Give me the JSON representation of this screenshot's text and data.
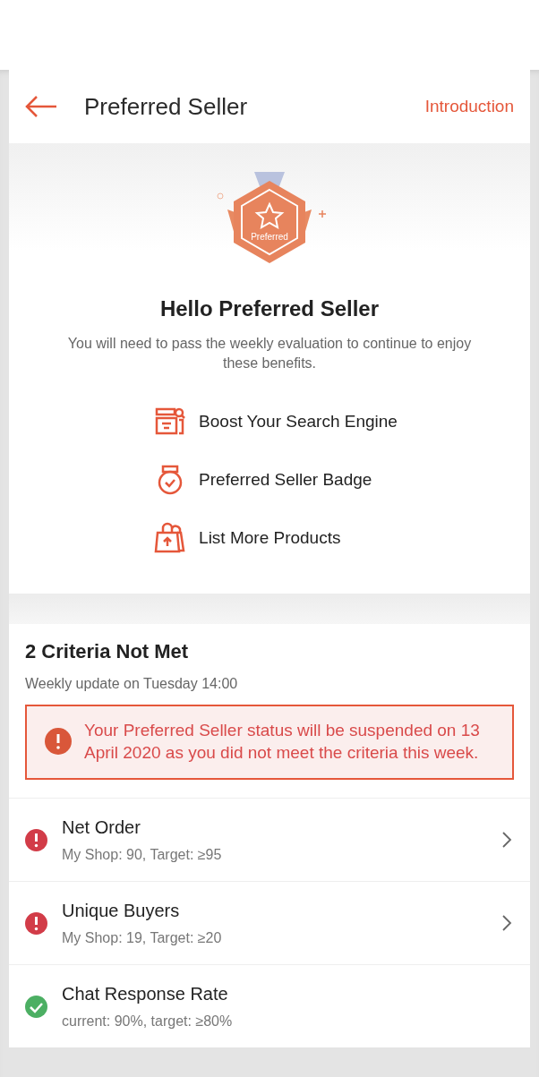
{
  "header": {
    "title": "Preferred Seller",
    "link": "Introduction"
  },
  "hero": {
    "badge_label": "Preferred",
    "title": "Hello Preferred Seller",
    "subtitle": "You will need to pass the weekly evaluation to continue to enjoy these benefits."
  },
  "benefits": [
    {
      "kind": "search",
      "label": "Boost Your Search Engine"
    },
    {
      "kind": "badge",
      "label": "Preferred Seller Badge"
    },
    {
      "kind": "products",
      "label": "List More Products"
    }
  ],
  "criteria": {
    "title": "2 Criteria Not Met",
    "update": "Weekly update on Tuesday 14:00",
    "warning": "Your Preferred Seller status will be suspended on 13 April 2020 as you did not meet the criteria this week.",
    "items": [
      {
        "name": "Net Order",
        "detail": "My Shop: 90, Target: ≥95",
        "met": false
      },
      {
        "name": "Unique Buyers",
        "detail": "My Shop: 19, Target: ≥20",
        "met": false
      },
      {
        "name": "Chat Response Rate",
        "detail": "current: 90%, target: ≥80%",
        "met": true
      }
    ]
  }
}
